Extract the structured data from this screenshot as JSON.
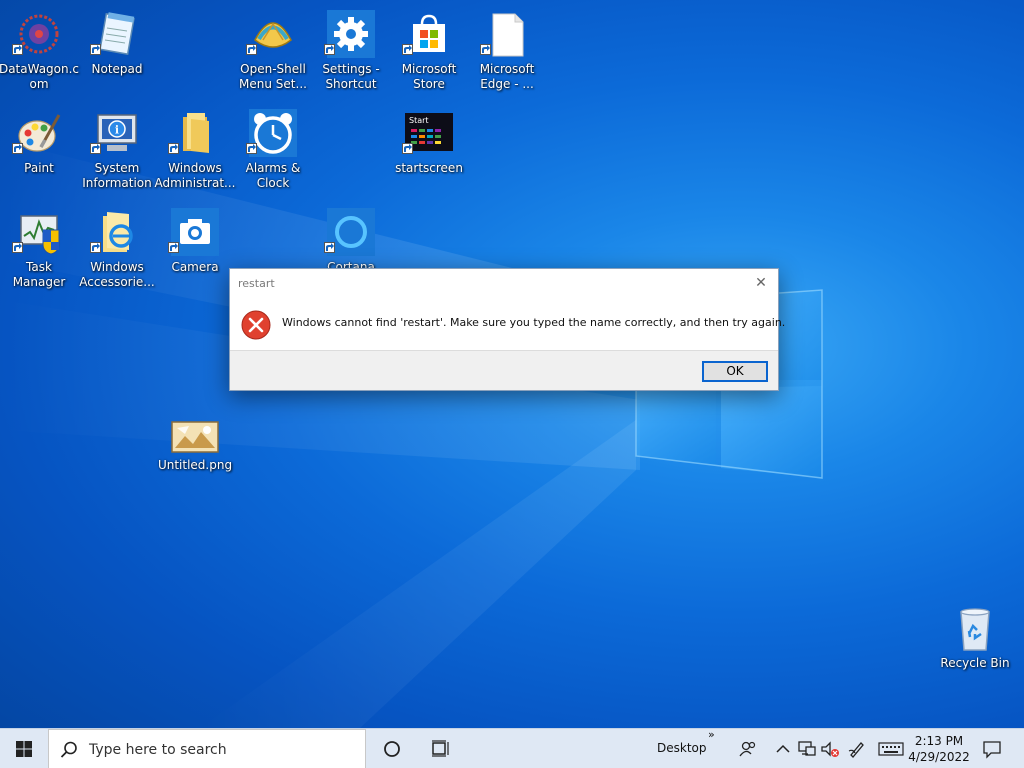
{
  "desktop": {
    "icons": [
      {
        "label": "DataWagon.com",
        "icon": "datawagon-icon"
      },
      {
        "label": "Notepad",
        "icon": "notepad-icon"
      },
      {
        "label": "Open-Shell Menu Set...",
        "icon": "open-shell-icon"
      },
      {
        "label": "Settings - Shortcut",
        "icon": "settings-icon"
      },
      {
        "label": "Microsoft Store",
        "icon": "store-icon"
      },
      {
        "label": "Microsoft Edge - ...",
        "icon": "edge-file-icon"
      },
      {
        "label": "Paint",
        "icon": "paint-icon"
      },
      {
        "label": "System Information",
        "icon": "system-info-icon"
      },
      {
        "label": "Windows Administrat...",
        "icon": "folder-icon"
      },
      {
        "label": "Alarms & Clock",
        "icon": "alarm-clock-icon"
      },
      {
        "label": "startscreen",
        "icon": "startscreen-icon"
      },
      {
        "label": "Task Manager",
        "icon": "task-manager-icon"
      },
      {
        "label": "Windows Accessorie...",
        "icon": "accessories-icon"
      },
      {
        "label": "Camera",
        "icon": "camera-icon"
      },
      {
        "label": "Cortana",
        "icon": "cortana-icon"
      },
      {
        "label": "Untitled.png",
        "icon": "image-file-icon"
      },
      {
        "label": "Recycle Bin",
        "icon": "recycle-bin-icon"
      }
    ],
    "startscreen_thumb_text": "Start"
  },
  "dialog": {
    "title": "restart",
    "close_glyph": "✕",
    "message": "Windows cannot find 'restart'. Make sure you typed the name correctly, and then try again.",
    "ok_label": "OK"
  },
  "taskbar": {
    "search_placeholder": "Type here to search",
    "desktop_label": "Desktop",
    "overflow_glyph": "»",
    "time": "2:13 PM",
    "date": "4/29/2022"
  },
  "colors": {
    "accent": "#0a64cf",
    "error": "#e0412f",
    "taskbar": "#dfe8f4"
  }
}
